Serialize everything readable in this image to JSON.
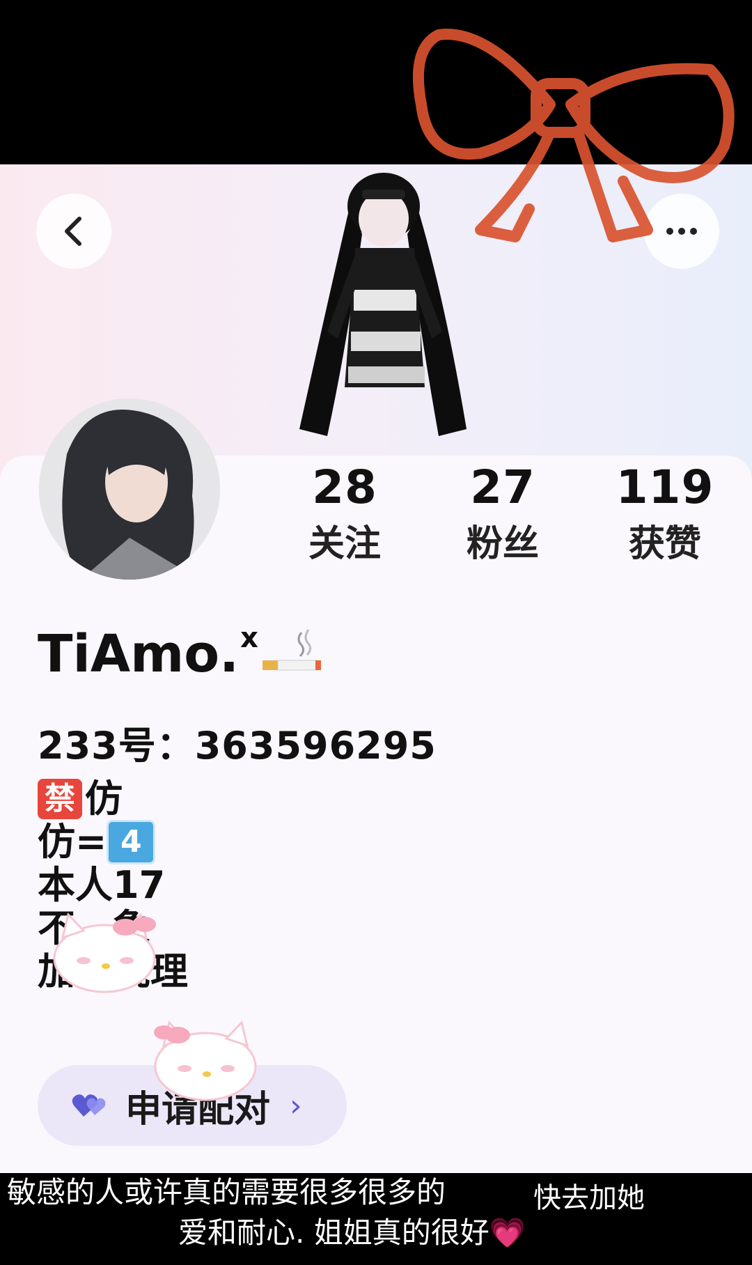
{
  "profile": {
    "username": "TiAmo.",
    "username_sup": "x",
    "id_label": "233号：363596295",
    "stats": [
      {
        "value": "28",
        "label": "关注"
      },
      {
        "value": "27",
        "label": "粉丝"
      },
      {
        "value": "119",
        "label": "获赞"
      }
    ],
    "bio": {
      "ban_emoji": "禁",
      "line1_text": "仿",
      "line2_text": "仿=",
      "four_emoji": "4",
      "line3": "本人17",
      "line4": "不…象",
      "line5": "加友说理"
    },
    "pair_button": "申请配对",
    "pair_chevron": "›"
  },
  "nav": {
    "back_icon": "back-chevron-icon",
    "more_icon": "more-dots-icon"
  },
  "caption": {
    "line1": "敏感的人或许真的需要很多很多的",
    "line2": "快去加她",
    "line3": "爱和耐心. 姐姐真的很好💗"
  },
  "colors": {
    "bow": "#d9532f",
    "accent": "#5b5ad0",
    "card_bg": "#fbf8fd"
  }
}
